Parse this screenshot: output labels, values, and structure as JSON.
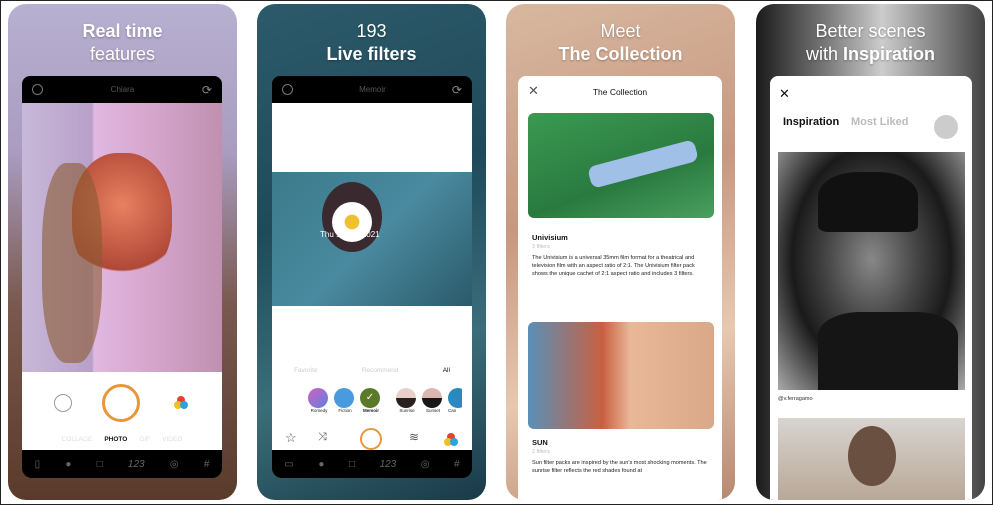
{
  "panels": [
    {
      "heading_line1": "Real time",
      "heading_line2": "features",
      "screen_title": "Chiara",
      "modes": [
        "COLLAGE",
        "PHOTO",
        "GIF",
        "VIDEO"
      ],
      "active_mode": "PHOTO",
      "toolbar_counter": "123"
    },
    {
      "heading_line1": "193",
      "heading_line2": "Live filters",
      "screen_title": "Memoir",
      "photo_date_stamp": "Thu 14 Oct 2021",
      "filter_tabs": [
        "Favorite",
        "Recommend",
        "All"
      ],
      "active_tab": "All",
      "filters": [
        "Romedy",
        "Fiction",
        "Memoir",
        "Sunrise",
        "Sunset",
        "Can"
      ],
      "selected_filter": "Memoir",
      "toolbar_counter": "123"
    },
    {
      "heading_line1": "Meet",
      "heading_line2": "The Collection",
      "screen_title": "The Collection",
      "items": [
        {
          "name": "Univisium",
          "count": "3 filters",
          "description": "The Univisium is a universal 35mm film format for a theatrical and television film with an aspect ratio of 2:1. The Univisium filter pack shows the unique cachet of 2:1 aspect ratio and includes 3 filters."
        },
        {
          "name": "SUN",
          "count": "2 filters",
          "description": "Sun filter packs are inspired by the sun's most shocking moments. The sunrise filter reflects the red shades found at"
        }
      ]
    },
    {
      "heading_line1": "Better scenes",
      "heading_line2_prefix": "with ",
      "heading_line2": "Inspiration",
      "tabs": [
        "Inspiration",
        "Most Liked"
      ],
      "active_tab": "Inspiration",
      "photo_credit": "@v.ferragamo"
    }
  ],
  "colors": {
    "accent": "#e8963a",
    "memoir_green": "#5a7a2a"
  }
}
